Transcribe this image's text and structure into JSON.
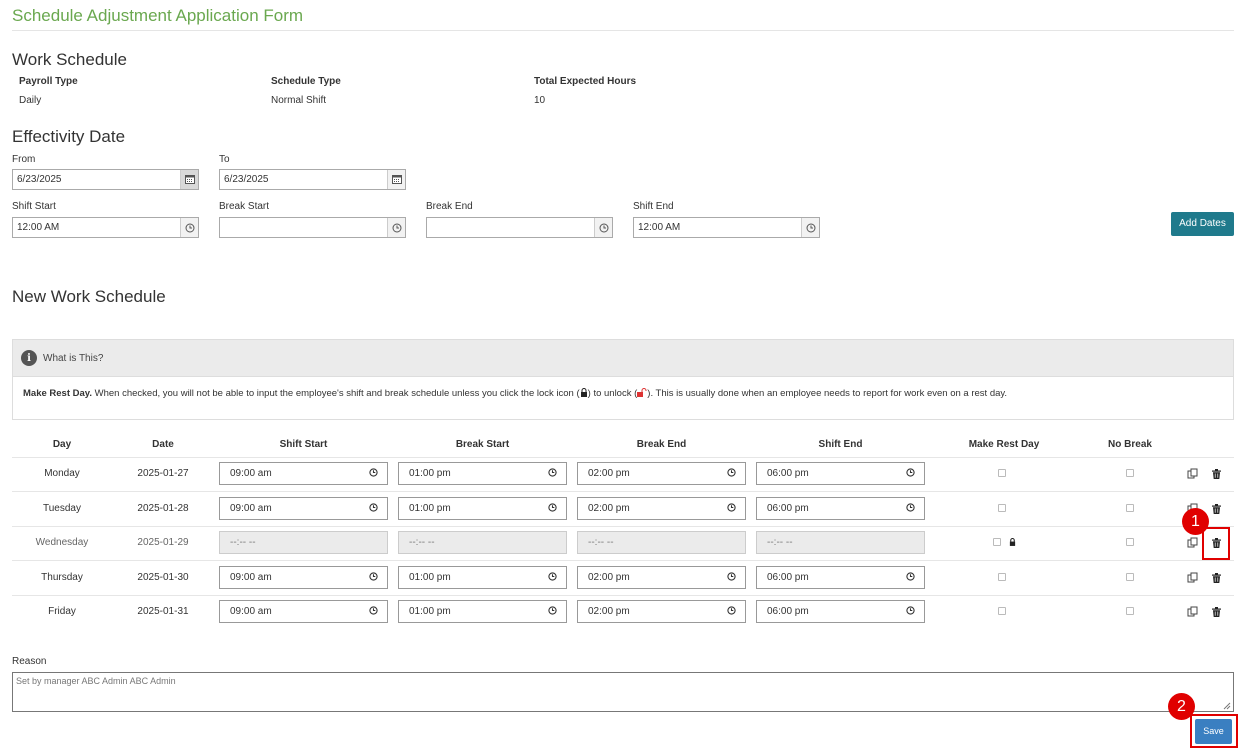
{
  "form_title": "Schedule Adjustment Application Form",
  "work_schedule": {
    "heading": "Work Schedule",
    "payroll_type_label": "Payroll Type",
    "payroll_type_value": "Daily",
    "schedule_type_label": "Schedule Type",
    "schedule_type_value": "Normal Shift",
    "total_hours_label": "Total Expected Hours",
    "total_hours_value": "10"
  },
  "effectivity": {
    "heading": "Effectivity Date",
    "from_label": "From",
    "from_value": "6/23/2025",
    "to_label": "To",
    "to_value": "6/23/2025",
    "shift_start_label": "Shift Start",
    "shift_start_value": "12:00 AM",
    "break_start_label": "Break Start",
    "break_start_value": "",
    "break_end_label": "Break End",
    "break_end_value": "",
    "shift_end_label": "Shift End",
    "shift_end_value": "12:00 AM",
    "add_dates_label": "Add Dates"
  },
  "new_schedule": {
    "heading": "New Work Schedule",
    "info_title": "What is This?",
    "info_bold": "Make Rest Day.",
    "info_text_before_lock": " When checked, you will not be able to input the employee's shift and break schedule unless you click the lock icon (",
    "info_text_middle": ") to unlock (",
    "info_text_after": "). This is usually done when an employee needs to report for work even on a rest day."
  },
  "table": {
    "headers": {
      "day": "Day",
      "date": "Date",
      "shift_start": "Shift Start",
      "break_start": "Break Start",
      "break_end": "Break End",
      "shift_end": "Shift End",
      "rest_day": "Make Rest Day",
      "no_break": "No Break"
    },
    "rows": [
      {
        "day": "Monday",
        "date": "2025-01-27",
        "shift_start": "09:00 am",
        "break_start": "01:00 pm",
        "break_end": "02:00 pm",
        "shift_end": "06:00 pm"
      },
      {
        "day": "Tuesday",
        "date": "2025-01-28",
        "shift_start": "09:00 am",
        "break_start": "01:00 pm",
        "break_end": "02:00 pm",
        "shift_end": "06:00 pm"
      },
      {
        "day": "Wednesday",
        "date": "2025-01-29",
        "shift_start": "--:-- --",
        "break_start": "--:-- --",
        "break_end": "--:-- --",
        "shift_end": "--:-- --"
      },
      {
        "day": "Thursday",
        "date": "2025-01-30",
        "shift_start": "09:00 am",
        "break_start": "01:00 pm",
        "break_end": "02:00 pm",
        "shift_end": "06:00 pm"
      },
      {
        "day": "Friday",
        "date": "2025-01-31",
        "shift_start": "09:00 am",
        "break_start": "01:00 pm",
        "break_end": "02:00 pm",
        "shift_end": "06:00 pm"
      }
    ]
  },
  "reason": {
    "label": "Reason",
    "value": "Set by manager ABC Admin ABC Admin"
  },
  "save_label": "Save",
  "annotations": {
    "badge_1": "1",
    "badge_2": "2",
    "color": "#e00000"
  }
}
